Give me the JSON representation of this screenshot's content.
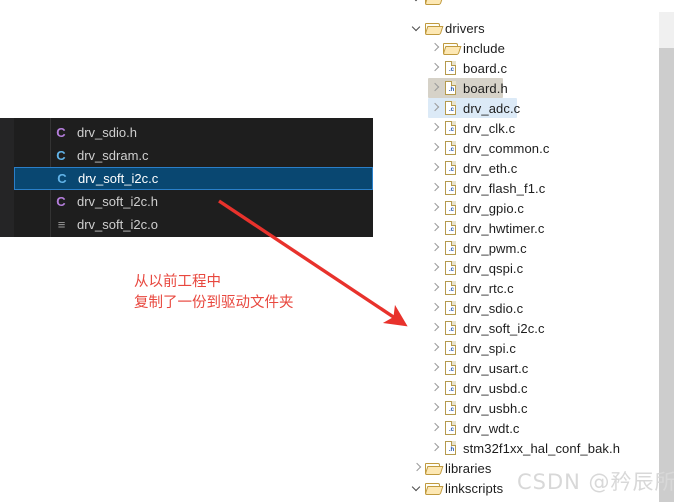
{
  "tree": {
    "partial_top_row": {
      "label": "",
      "icon": "folder-open-icon"
    },
    "rows": [
      {
        "label": "drivers",
        "type": "folder",
        "state": "expanded",
        "indent": 1,
        "highlight": "none"
      },
      {
        "label": "include",
        "type": "folder",
        "state": "collapsed",
        "indent": 2,
        "highlight": "none"
      },
      {
        "label": "board.c",
        "type": "file",
        "ext": ".c",
        "state": "collapsed",
        "indent": 2,
        "highlight": "none"
      },
      {
        "label": "board.h",
        "type": "file",
        "ext": ".h",
        "state": "collapsed",
        "indent": 2,
        "highlight": "gray"
      },
      {
        "label": "drv_adc.c",
        "type": "file",
        "ext": ".c",
        "state": "collapsed",
        "indent": 2,
        "highlight": "blue"
      },
      {
        "label": "drv_clk.c",
        "type": "file",
        "ext": ".c",
        "state": "collapsed",
        "indent": 2,
        "highlight": "none"
      },
      {
        "label": "drv_common.c",
        "type": "file",
        "ext": ".c",
        "state": "collapsed",
        "indent": 2,
        "highlight": "none"
      },
      {
        "label": "drv_eth.c",
        "type": "file",
        "ext": ".c",
        "state": "collapsed",
        "indent": 2,
        "highlight": "none"
      },
      {
        "label": "drv_flash_f1.c",
        "type": "file",
        "ext": ".c",
        "state": "collapsed",
        "indent": 2,
        "highlight": "none"
      },
      {
        "label": "drv_gpio.c",
        "type": "file",
        "ext": ".c",
        "state": "collapsed",
        "indent": 2,
        "highlight": "none"
      },
      {
        "label": "drv_hwtimer.c",
        "type": "file",
        "ext": ".c",
        "state": "collapsed",
        "indent": 2,
        "highlight": "none"
      },
      {
        "label": "drv_pwm.c",
        "type": "file",
        "ext": ".c",
        "state": "collapsed",
        "indent": 2,
        "highlight": "none"
      },
      {
        "label": "drv_qspi.c",
        "type": "file",
        "ext": ".c",
        "state": "collapsed",
        "indent": 2,
        "highlight": "none"
      },
      {
        "label": "drv_rtc.c",
        "type": "file",
        "ext": ".c",
        "state": "collapsed",
        "indent": 2,
        "highlight": "none"
      },
      {
        "label": "drv_sdio.c",
        "type": "file",
        "ext": ".c",
        "state": "collapsed",
        "indent": 2,
        "highlight": "none"
      },
      {
        "label": "drv_soft_i2c.c",
        "type": "file",
        "ext": ".c",
        "state": "collapsed",
        "indent": 2,
        "highlight": "none"
      },
      {
        "label": "drv_spi.c",
        "type": "file",
        "ext": ".c",
        "state": "collapsed",
        "indent": 2,
        "highlight": "none"
      },
      {
        "label": "drv_usart.c",
        "type": "file",
        "ext": ".c",
        "state": "collapsed",
        "indent": 2,
        "highlight": "none"
      },
      {
        "label": "drv_usbd.c",
        "type": "file",
        "ext": ".c",
        "state": "collapsed",
        "indent": 2,
        "highlight": "none"
      },
      {
        "label": "drv_usbh.c",
        "type": "file",
        "ext": ".c",
        "state": "collapsed",
        "indent": 2,
        "highlight": "none"
      },
      {
        "label": "drv_wdt.c",
        "type": "file",
        "ext": ".c",
        "state": "collapsed",
        "indent": 2,
        "highlight": "none"
      },
      {
        "label": "stm32f1xx_hal_conf_bak.h",
        "type": "file",
        "ext": ".h",
        "state": "collapsed",
        "indent": 2,
        "highlight": "none"
      },
      {
        "label": "libraries",
        "type": "folder",
        "state": "collapsed",
        "indent": 1,
        "highlight": "none"
      },
      {
        "label": "linkscripts",
        "type": "folder",
        "state": "expanded",
        "indent": 1,
        "highlight": "none"
      }
    ],
    "highlight_box_target": "drv_soft_i2c.c",
    "highlight_box_color": "#e8191e"
  },
  "dark_panel": {
    "rows": [
      {
        "label": "drv_sdio.h",
        "icon": "c-file-icon",
        "icon_glyph": "C",
        "icon_color": "#b57edc",
        "selected": false
      },
      {
        "label": "drv_sdram.c",
        "icon": "c-file-icon",
        "icon_glyph": "C",
        "icon_color": "#61b3e8",
        "selected": false
      },
      {
        "label": "drv_soft_i2c.c",
        "icon": "c-file-icon",
        "icon_glyph": "C",
        "icon_color": "#61b3e8",
        "selected": true
      },
      {
        "label": "drv_soft_i2c.h",
        "icon": "c-file-icon",
        "icon_glyph": "C",
        "icon_color": "#b57edc",
        "selected": false
      },
      {
        "label": "drv_soft_i2c.o",
        "icon": "object-file-icon",
        "icon_glyph": "≡",
        "icon_color": "#9a9a9a",
        "selected": false
      }
    ],
    "selection_color": "#094771",
    "background_color": "#1e1e1e"
  },
  "annotation": {
    "text": "从以前工程中\n复制了一份到驱动文件夹",
    "color": "#e8483f",
    "arrow_color": "#e8322c"
  },
  "watermark": {
    "text": "CSDN @矜辰所致"
  }
}
